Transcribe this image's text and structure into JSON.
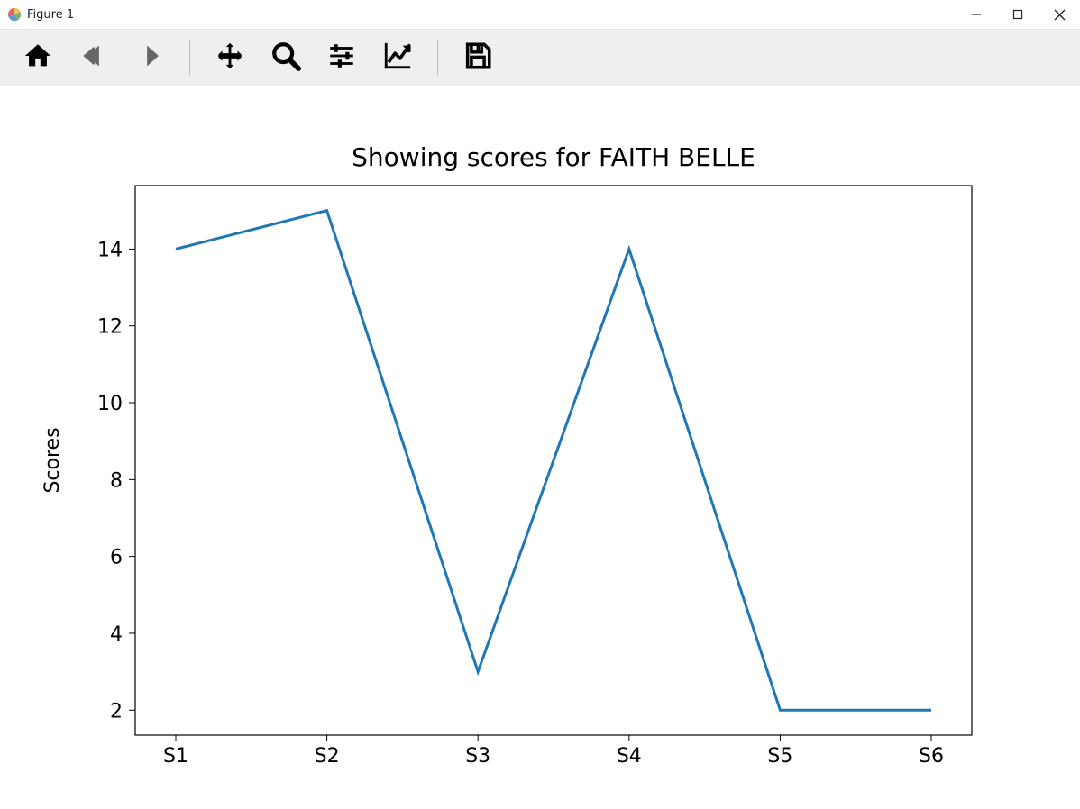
{
  "window": {
    "title": "Figure 1"
  },
  "toolbar": {
    "buttons": [
      {
        "name": "home-button",
        "icon": "home-icon"
      },
      {
        "name": "back-button",
        "icon": "arrow-left-icon",
        "disabled": true
      },
      {
        "name": "forward-button",
        "icon": "arrow-right-icon",
        "disabled": true
      },
      {
        "name": "pan-button",
        "icon": "move-icon"
      },
      {
        "name": "zoom-button",
        "icon": "magnify-icon"
      },
      {
        "name": "configure-subplots-button",
        "icon": "sliders-icon"
      },
      {
        "name": "edit-axes-button",
        "icon": "chart-line-icon"
      },
      {
        "name": "save-button",
        "icon": "save-icon"
      }
    ]
  },
  "chart_data": {
    "type": "line",
    "title": "Showing scores for FAITH BELLE",
    "xlabel": "",
    "ylabel": "Scores",
    "categories": [
      "S1",
      "S2",
      "S3",
      "S4",
      "S5",
      "S6"
    ],
    "values": [
      14,
      15,
      3,
      14,
      2,
      2
    ],
    "x_tick_labels": [
      "S1",
      "S2",
      "S3",
      "S4",
      "S5",
      "S6"
    ],
    "y_ticks": [
      2,
      4,
      6,
      8,
      10,
      12,
      14
    ],
    "ylim": [
      1.35,
      15.65
    ],
    "line_color": "#1f77b4"
  }
}
